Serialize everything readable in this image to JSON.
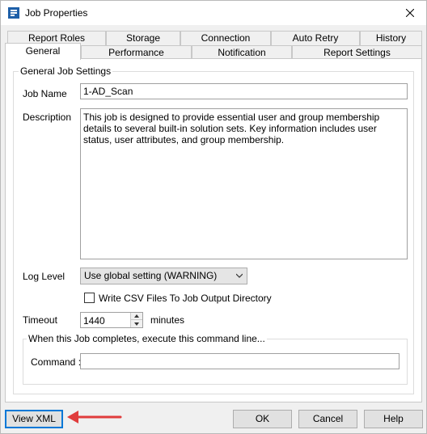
{
  "window": {
    "title": "Job Properties",
    "accent": "#1e5fa8",
    "annotation_color": "#e03c3c"
  },
  "tabs_row1": [
    {
      "label": "Report Roles"
    },
    {
      "label": "Storage"
    },
    {
      "label": "Connection"
    },
    {
      "label": "Auto Retry"
    },
    {
      "label": "History"
    }
  ],
  "tabs_row2": [
    {
      "label": "General",
      "selected": true
    },
    {
      "label": "Performance"
    },
    {
      "label": "Notification"
    },
    {
      "label": "Report Settings"
    }
  ],
  "general": {
    "group_title": "General Job Settings",
    "job_name_label": "Job Name",
    "job_name_value": "1-AD_Scan",
    "description_label": "Description",
    "description_value": "This job is designed to provide essential user and group membership details to several built-in solution sets. Key information includes user status, user attributes, and group membership.",
    "log_level_label": "Log Level",
    "log_level_value": "Use global setting (WARNING)",
    "csv_checkbox_label": "Write CSV Files To Job Output Directory",
    "csv_checked": false,
    "timeout_label": "Timeout",
    "timeout_value": "1440",
    "timeout_unit": "minutes",
    "command_group_title": "When this Job completes, execute this command line...",
    "command_label": "Command :",
    "command_value": ""
  },
  "buttons": {
    "view_xml": "View XML",
    "ok": "OK",
    "cancel": "Cancel",
    "help": "Help"
  }
}
